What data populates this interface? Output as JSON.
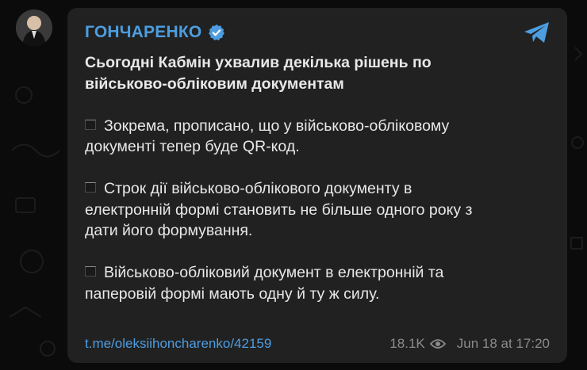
{
  "channel": {
    "name": "ГОНЧАРЕНКО",
    "link": "t.me/oleksiihoncharenko/42159",
    "views": "18.1K",
    "timestamp": "Jun 18 at 17:20"
  },
  "post": {
    "headline_line1": "Сьогодні Кабмін ухвалив декілька рішень по",
    "headline_line2": "військово-обліковим документам",
    "p1_line1": "Зокрема, прописано, що у військово-обліковому",
    "p1_line2": "документі тепер буде QR-код.",
    "p2_line1": "Строк дії військово-облікового документу в",
    "p2_line2": "електронній формі становить не більше одного року з",
    "p2_line3": "дати його формування.",
    "p3_line1": "Військово-обліковий документ в електронній та",
    "p3_line2": "паперовій формі мають одну й ту ж силу."
  },
  "icons": {
    "verified": "verified-badge-icon",
    "share": "share-icon",
    "views": "eye-icon",
    "bullet": "black-square-icon"
  },
  "colors": {
    "accent": "#4d9de0",
    "card_bg": "#212121",
    "page_bg": "#0b0b0b",
    "text": "#e8e8e8",
    "meta": "#8b8b8b"
  }
}
